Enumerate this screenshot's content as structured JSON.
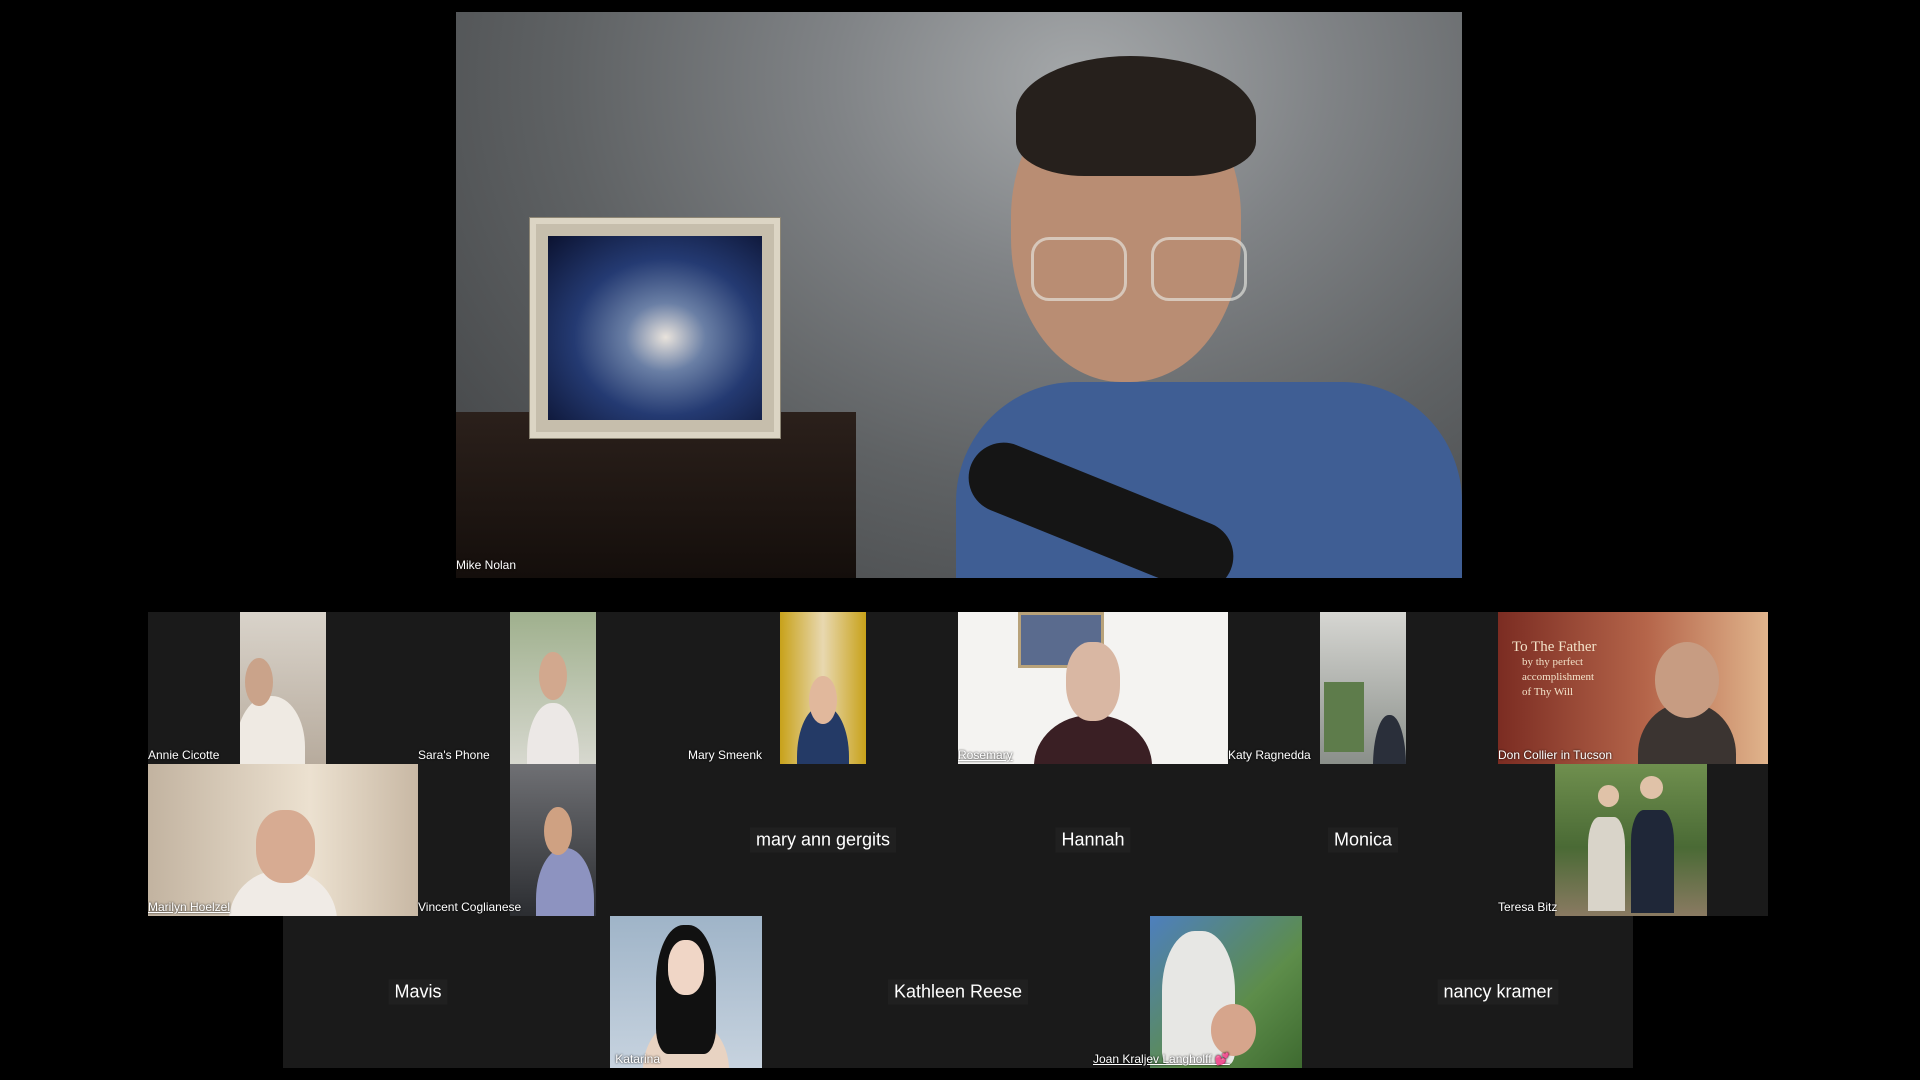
{
  "speaker": {
    "name": "Mike Nolan"
  },
  "participants": [
    {
      "name": "Annie Cicotte"
    },
    {
      "name": "Sara's Phone"
    },
    {
      "name": "Mary Smeenk"
    },
    {
      "name": "Rosemary"
    },
    {
      "name": "Katy Ragnedda"
    },
    {
      "name": "Don Collier in Tucson"
    },
    {
      "name": "Marilyn Hoelzel"
    },
    {
      "name": "Vincent Coglianese"
    },
    {
      "name": "mary ann gergits"
    },
    {
      "name": "Hannah"
    },
    {
      "name": "Monica"
    },
    {
      "name": "Teresa Bitz"
    },
    {
      "name": "Mavis"
    },
    {
      "name": "Katarina"
    },
    {
      "name": "Kathleen Reese"
    },
    {
      "name": "Joan Kraljev Langholff 💕"
    },
    {
      "name": "nancy kramer"
    }
  ],
  "don_video_text": [
    "To The Father",
    "by thy perfect",
    "accomplishment",
    "of Thy Will"
  ]
}
